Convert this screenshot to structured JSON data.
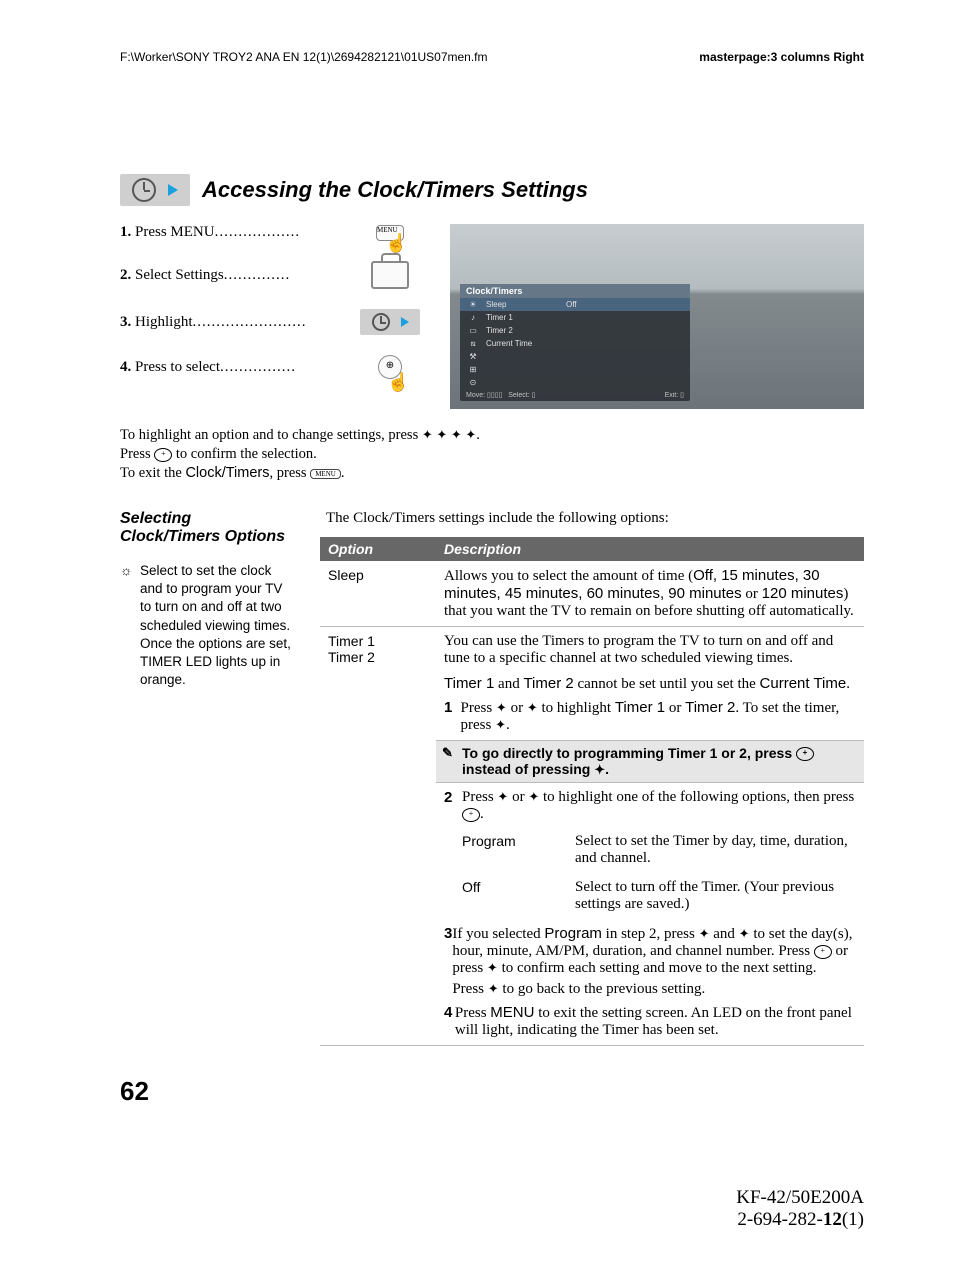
{
  "top": {
    "path": "F:\\Worker\\SONY TROY2 ANA EN 12(1)\\2694282121\\01US07men.fm",
    "master": "masterpage:3 columns Right"
  },
  "title": "Accessing the Clock/Timers Settings",
  "steps": {
    "s1": {
      "n": "1.",
      "t": "Press MENU",
      "dots": ".................."
    },
    "s2": {
      "n": "2.",
      "t": "Select Settings",
      "dots": ".............."
    },
    "s3": {
      "n": "3.",
      "t": "Highlight",
      "dots": "........................"
    },
    "s4": {
      "n": "4.",
      "t": "Press to select",
      "dots": "................"
    }
  },
  "osd": {
    "title": "Clock/Timers",
    "r1": "Sleep",
    "r1v": "Off",
    "r2": "Timer 1",
    "r3": "Timer 2",
    "r4": "Current Time",
    "footer_move": "Move:",
    "footer_select": "Select:",
    "footer_exit": "Exit:"
  },
  "notes": {
    "l1a": "To highlight an option and to change settings, press ",
    "l1b": ".",
    "l2a": "Press ",
    "l2b": " to confirm the selection.",
    "l3a": "To exit the ",
    "l3clk": "Clock/Timers",
    "l3b": ", press ",
    "l3c": "."
  },
  "sidebar": {
    "title": "Selecting Clock/Timers Options",
    "tip": "Select to set the clock and to program your TV to turn on and off at two scheduled viewing times. Once the options are set, TIMER LED lights up in orange."
  },
  "intro": "The Clock/Timers settings include the following options:",
  "thead": {
    "opt": "Option",
    "desc": "Description"
  },
  "rows": {
    "sleep": {
      "name": "Sleep",
      "a": "Allows you to select the amount of time (",
      "vals": "Off, 15 minutes, 30 minutes, 45 minutes, 60 minutes, 90 minutes",
      "b": " or ",
      "vals2": "120 minutes",
      "c": ") that you want the TV to remain on before shutting off automatically."
    },
    "timers": {
      "name1": "Timer 1",
      "name2": "Timer 2",
      "p1": "You can use the Timers to program the TV to turn on and off and tune to a specific channel at two scheduled viewing times.",
      "p2a": "Timer 1",
      "p2b": " and ",
      "p2c": "Timer 2",
      "p2d": " cannot be set until you set the ",
      "p2e": "Current Time",
      "p2f": ".",
      "s1": {
        "n": "1",
        "a": "Press ",
        "b": " or ",
        "c": " to highlight ",
        "t1": "Timer 1",
        "d": " or ",
        "t2": "Timer 2",
        "e": ". To set the timer, press ",
        "f": "."
      },
      "note": {
        "a": "To go directly to programming Timer 1 or 2, press ",
        "b": " instead of pressing ",
        "c": "."
      },
      "s2": {
        "n": "2",
        "a": "Press ",
        "b": " or ",
        "c": " to highlight one of the following options, then press ",
        "d": ".",
        "k1": "Program",
        "v1": "Select to set the Timer by day, time, duration, and channel.",
        "k2": "Off",
        "v2": "Select to turn off the Timer. (Your previous settings are saved.)"
      },
      "s3": {
        "n": "3",
        "a": "If you selected ",
        "prog": "Program",
        "b": " in step 2, press ",
        "c": " and ",
        "d": " to set the day(s), hour, minute, AM/PM, duration, and channel number. Press ",
        "e": " or press ",
        "f": " to confirm each setting and move to the next setting.",
        "g": "Press ",
        "h": " to go back to the previous setting."
      },
      "s4": {
        "n": "4",
        "a": "Press ",
        "menu": "MENU",
        "b": " to exit the setting screen. An LED on the front panel will light, indicating the Timer has been set."
      }
    }
  },
  "page_number": "62",
  "foot1": "KF-42/50E200A",
  "foot2a": "2-694-282-",
  "foot2b": "12",
  "foot2c": "(1)"
}
